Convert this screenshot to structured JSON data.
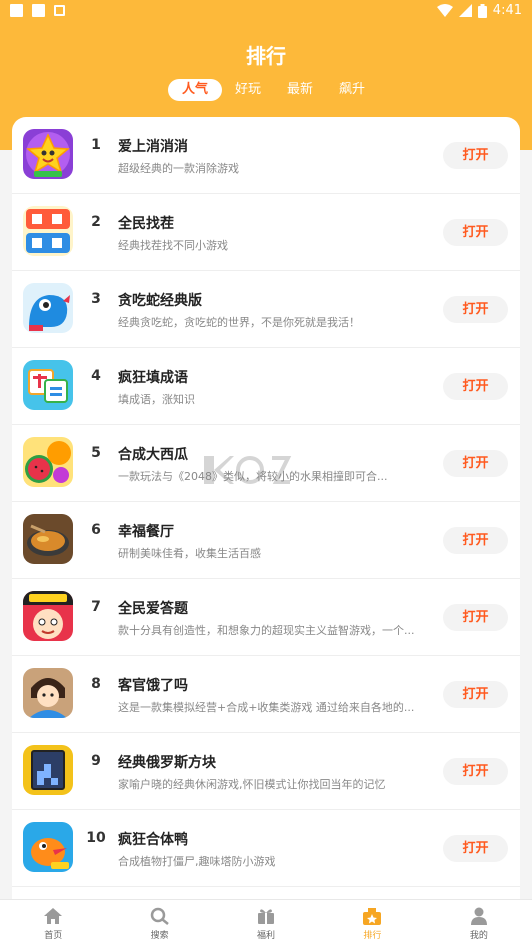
{
  "status_bar": {
    "time": "4:41"
  },
  "header": {
    "title": "排行",
    "tabs": [
      {
        "label": "人气",
        "active": true
      },
      {
        "label": "好玩",
        "active": false
      },
      {
        "label": "最新",
        "active": false
      },
      {
        "label": "飙升",
        "active": false
      }
    ]
  },
  "ranking": {
    "items": [
      {
        "rank": "1",
        "name": "爱上消消消",
        "desc": "超级经典的一款消除游戏",
        "button": "打开"
      },
      {
        "rank": "2",
        "name": "全民找茬",
        "desc": "经典找茬找不同小游戏",
        "button": "打开"
      },
      {
        "rank": "3",
        "name": "贪吃蛇经典版",
        "desc": "经典贪吃蛇，贪吃蛇的世界，不是你死就是我活！",
        "button": "打开"
      },
      {
        "rank": "4",
        "name": "疯狂填成语",
        "desc": "填成语，涨知识",
        "button": "打开"
      },
      {
        "rank": "5",
        "name": "合成大西瓜",
        "desc": "一款玩法与《2048》类似，将较小的水果相撞即可合...",
        "button": "打开"
      },
      {
        "rank": "6",
        "name": "幸福餐厅",
        "desc": "研制美味佳肴，收集生活百感",
        "button": "打开"
      },
      {
        "rank": "7",
        "name": "全民爱答题",
        "desc": "款十分具有创造性，和想象力的超现实主义益智游戏，一个...",
        "button": "打开"
      },
      {
        "rank": "8",
        "name": "客官饿了吗",
        "desc": "这是一款集模拟经营+合成+收集类游戏 通过给来自各地的...",
        "button": "打开"
      },
      {
        "rank": "9",
        "name": "经典俄罗斯方块",
        "desc": "家喻户晓的经典休闲游戏,怀旧模式让你找回当年的记忆",
        "button": "打开"
      },
      {
        "rank": "10",
        "name": "疯狂合体鸭",
        "desc": "合成植物打僵尸,趣味塔防小游戏",
        "button": "打开"
      }
    ]
  },
  "bottom_nav": [
    {
      "label": "首页",
      "icon": "home-icon",
      "active": false
    },
    {
      "label": "搜索",
      "icon": "search-icon",
      "active": false
    },
    {
      "label": "福利",
      "icon": "gift-icon",
      "active": false
    },
    {
      "label": "排行",
      "icon": "ranking-icon",
      "active": true
    },
    {
      "label": "我的",
      "icon": "user-icon",
      "active": false
    }
  ],
  "colors": {
    "header": "#fdb93a",
    "accent": "#ff5a1f",
    "nav_active": "#f6a623"
  }
}
